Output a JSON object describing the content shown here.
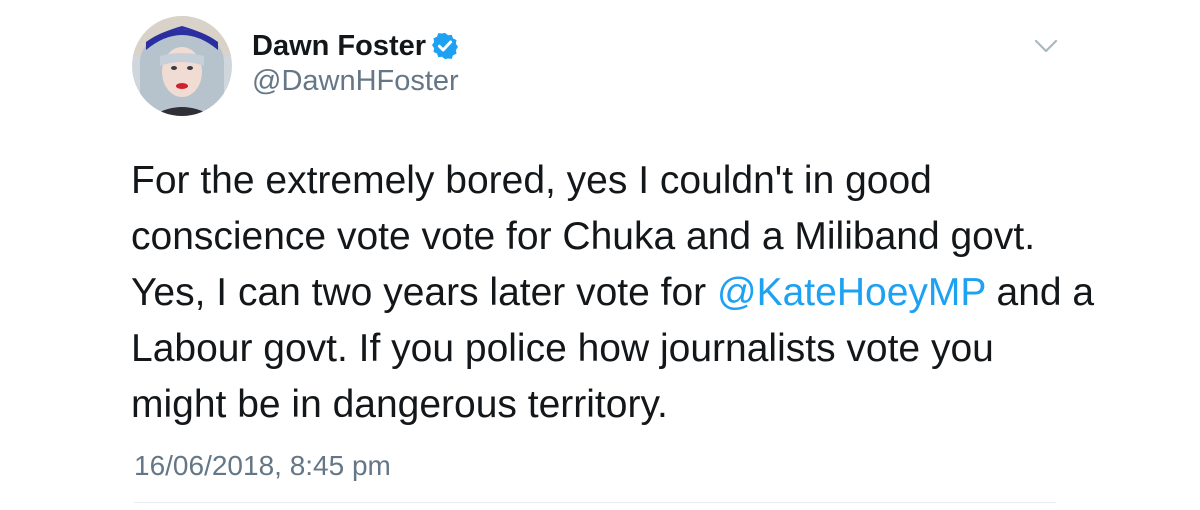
{
  "author": {
    "display_name": "Dawn Foster",
    "handle": "@DawnHFoster",
    "verified": true,
    "verified_icon": "verified-badge-icon",
    "avatar_icon": "avatar-photo"
  },
  "menu": {
    "icon": "chevron-down-icon"
  },
  "tweet": {
    "line1": "For the extremely bored, yes I couldn't in good",
    "line2": "conscience vote vote for Chuka and a Miliband govt.",
    "line3_before": "Yes, I can two years later vote for ",
    "mention": "@KateHoeyMP",
    "line3_after": " and a",
    "line4": "Labour govt. If you police how journalists vote you",
    "line5": "might be in dangerous territory."
  },
  "timestamp": "16/06/2018, 8:45 pm",
  "colors": {
    "text": "#14171a",
    "secondary": "#657786",
    "link": "#1da1f2",
    "divider": "#e6ecf0"
  }
}
